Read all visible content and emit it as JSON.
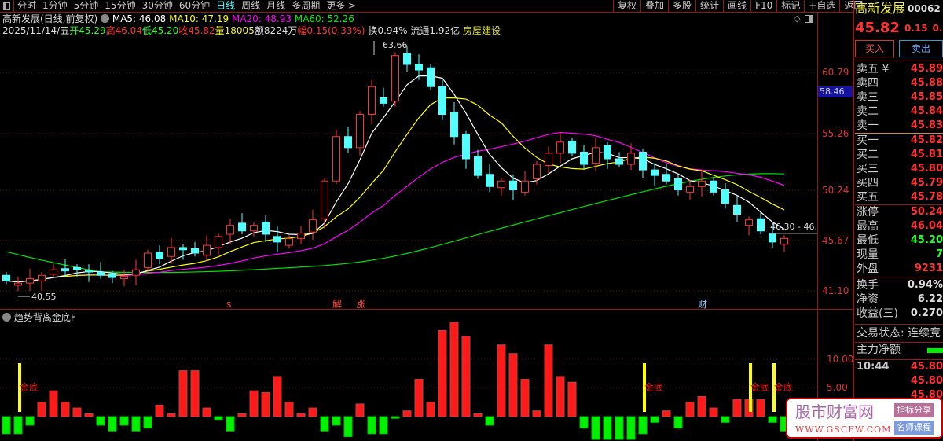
{
  "toolbar": {
    "tabs": [
      "分时",
      "1分钟",
      "5分钟",
      "15分钟",
      "30分钟",
      "60分钟",
      "日线",
      "周线",
      "月线",
      "多周期",
      "更多 >"
    ],
    "active": 6,
    "right_tools": [
      "复权",
      "叠加",
      "多股",
      "统计",
      "画线",
      "F10",
      "标记",
      "+自选",
      "返回"
    ]
  },
  "header": {
    "title": "高新发展(日线,前复权)",
    "ma5": "MA5: 46.08",
    "ma10": "MA10: 47.19",
    "ma20": "MA20: 48.93",
    "ma60": "MA60: 52.26",
    "date": "2025/11/14/五",
    "open": "开45.29",
    "high": "高46.04",
    "low": "低45.20",
    "close": "收45.82",
    "vol": "量18005",
    "amount": "额8224万",
    "change": "幅0.15(0.33%)",
    "turnover": "换0.94%",
    "float": "流通1.92亿",
    "sector": "房屋建设"
  },
  "price_axis": [
    "60.79",
    "55.26",
    "50.24",
    "45.67",
    "41.10"
  ],
  "current_price_tag": "58.46",
  "annotations": {
    "max": "63.66",
    "min": "40.55",
    "range": "46.30 - 46.2"
  },
  "events": [
    {
      "label": "s",
      "i": 19
    },
    {
      "label": "解",
      "i": 28
    },
    {
      "label": "涨",
      "i": 30
    },
    {
      "label": "财",
      "i": 59
    }
  ],
  "colors": {
    "up": "#ff3232",
    "down": "#54ffff",
    "ma5": "#ffffff",
    "ma10": "#ffff00",
    "ma20": "#ff00ff",
    "ma60": "#00e000",
    "ind_up": "#ff1a1a",
    "ind_down": "#00f000",
    "gold": "#ffff00"
  },
  "chart_data": {
    "type": "candlestick",
    "note_open": [
      42.5,
      41.6,
      41.8,
      42.0,
      42.6,
      43.1,
      43.2,
      42.9,
      42.8,
      42.6,
      42.2,
      42.5,
      43.2,
      44.6,
      44.2,
      45.0,
      44.9,
      44.3,
      45.0,
      46.2,
      47.2,
      46.5,
      47.3,
      46.0,
      45.2,
      45.8,
      46.4,
      47.6,
      51.0,
      55.0,
      54.0,
      57.0,
      58.5,
      58.2,
      62.5,
      61.5,
      61.2,
      59.5,
      57.2,
      55.2,
      53.2,
      51.6,
      50.4,
      51.0,
      50.0,
      51.2,
      52.4,
      53.5,
      54.6,
      53.6,
      52.6,
      54.2,
      53.0,
      52.5,
      53.6,
      52.0,
      51.6,
      51.2,
      50.0,
      50.5,
      51.0,
      50.2,
      48.8,
      47.0,
      47.6,
      46.3,
      45.29
    ],
    "close": [
      42.0,
      41.8,
      42.2,
      42.5,
      43.0,
      42.9,
      43.0,
      42.8,
      42.5,
      42.3,
      42.4,
      43.0,
      44.5,
      44.0,
      45.0,
      44.8,
      44.5,
      45.2,
      46.0,
      47.0,
      46.5,
      47.0,
      46.2,
      45.5,
      45.8,
      46.3,
      47.5,
      51.0,
      55.0,
      54.0,
      57.0,
      59.5,
      58.0,
      62.3,
      61.5,
      61.0,
      59.5,
      57.0,
      55.0,
      53.0,
      51.5,
      50.5,
      51.0,
      50.2,
      51.0,
      52.5,
      53.5,
      54.5,
      53.5,
      52.5,
      54.0,
      53.0,
      52.5,
      53.5,
      52.0,
      51.5,
      51.0,
      50.2,
      50.5,
      51.0,
      50.0,
      49.0,
      48.0,
      47.5,
      46.5,
      45.5,
      45.82
    ],
    "ylim": [
      41.1,
      63.66
    ]
  },
  "indicator": {
    "name": "趋势背离金底F",
    "axis": [
      "10.00",
      "5.00",
      "0.00"
    ],
    "signal_label": "金底",
    "values": [
      -3,
      -3,
      -1.5,
      2.5,
      4.5,
      2.5,
      1.5,
      0.5,
      -1.5,
      -2.5,
      -1.5,
      -2.5,
      -2,
      2,
      0.5,
      8,
      8,
      1.5,
      -0.5,
      -2.5,
      0.5,
      4.5,
      4.2,
      7,
      2.5,
      0.5,
      1.5,
      -2.5,
      -1.5,
      -3.5,
      2.2,
      -3,
      -3,
      -0.3,
      1,
      6.5,
      2.5,
      15,
      21,
      14,
      0.5,
      -1.5,
      12.5,
      11,
      6.5,
      1,
      12.5,
      7,
      6,
      -2,
      -4,
      -7,
      -9,
      -6,
      -3,
      -1,
      1,
      -2,
      2.5,
      3.5,
      1.5,
      -1,
      3,
      3,
      3,
      -1,
      -2.5,
      -1.5,
      -1,
      4.5,
      1,
      -1,
      -2,
      -3,
      -2.5,
      -4.5,
      -1.5,
      -1,
      0.5,
      -0.5,
      -1,
      -2,
      -2.5,
      -1,
      -3
    ],
    "signals": [
      1,
      54,
      63,
      65
    ]
  },
  "panel": {
    "name": "高新发展",
    "code": "00062",
    "price": "45.82",
    "chg": "0.15",
    "pct": "0.3",
    "buy": "买入",
    "sell": "卖出",
    "asks": [
      {
        "l": "卖五 ¥",
        "v": "45.89"
      },
      {
        "l": "卖四",
        "v": "45.88"
      },
      {
        "l": "卖三",
        "v": "45.85"
      },
      {
        "l": "卖二",
        "v": "45.84"
      },
      {
        "l": "卖一",
        "v": "45.83"
      }
    ],
    "bids": [
      {
        "l": "买一",
        "v": "45.82"
      },
      {
        "l": "买二",
        "v": "45.81"
      },
      {
        "l": "买三",
        "v": "45.80"
      },
      {
        "l": "买四",
        "v": "45.79"
      },
      {
        "l": "买五",
        "v": "45.78"
      }
    ],
    "stats": [
      {
        "l": "涨停",
        "v": "50.24",
        "c": "#f33"
      },
      {
        "l": "最高",
        "v": "46.04",
        "c": "#f33"
      },
      {
        "l": "最低",
        "v": "45.20",
        "c": "#2f2"
      },
      {
        "l": "现量",
        "v": "7",
        "c": "#2f2"
      },
      {
        "l": "外盘",
        "v": "9231",
        "c": "#f33"
      }
    ],
    "stats2": [
      {
        "l": "换手",
        "v": "0.94%"
      },
      {
        "l": "净资",
        "v": "6.22"
      },
      {
        "l": "收益(三)",
        "v": "0.270"
      }
    ],
    "trade_status": "交易状态: 连续竞",
    "main_net": "主力净额",
    "ticks": [
      {
        "t": "10:44",
        "v": "45.80"
      },
      {
        "t": "",
        "v": "45.80"
      },
      {
        "t": "",
        "v": "45.80"
      }
    ]
  },
  "watermark": {
    "name": "股市财富网",
    "url": "WWW.GSCFW.COM",
    "tag1": "指标分享",
    "tag2": "名师课程"
  }
}
